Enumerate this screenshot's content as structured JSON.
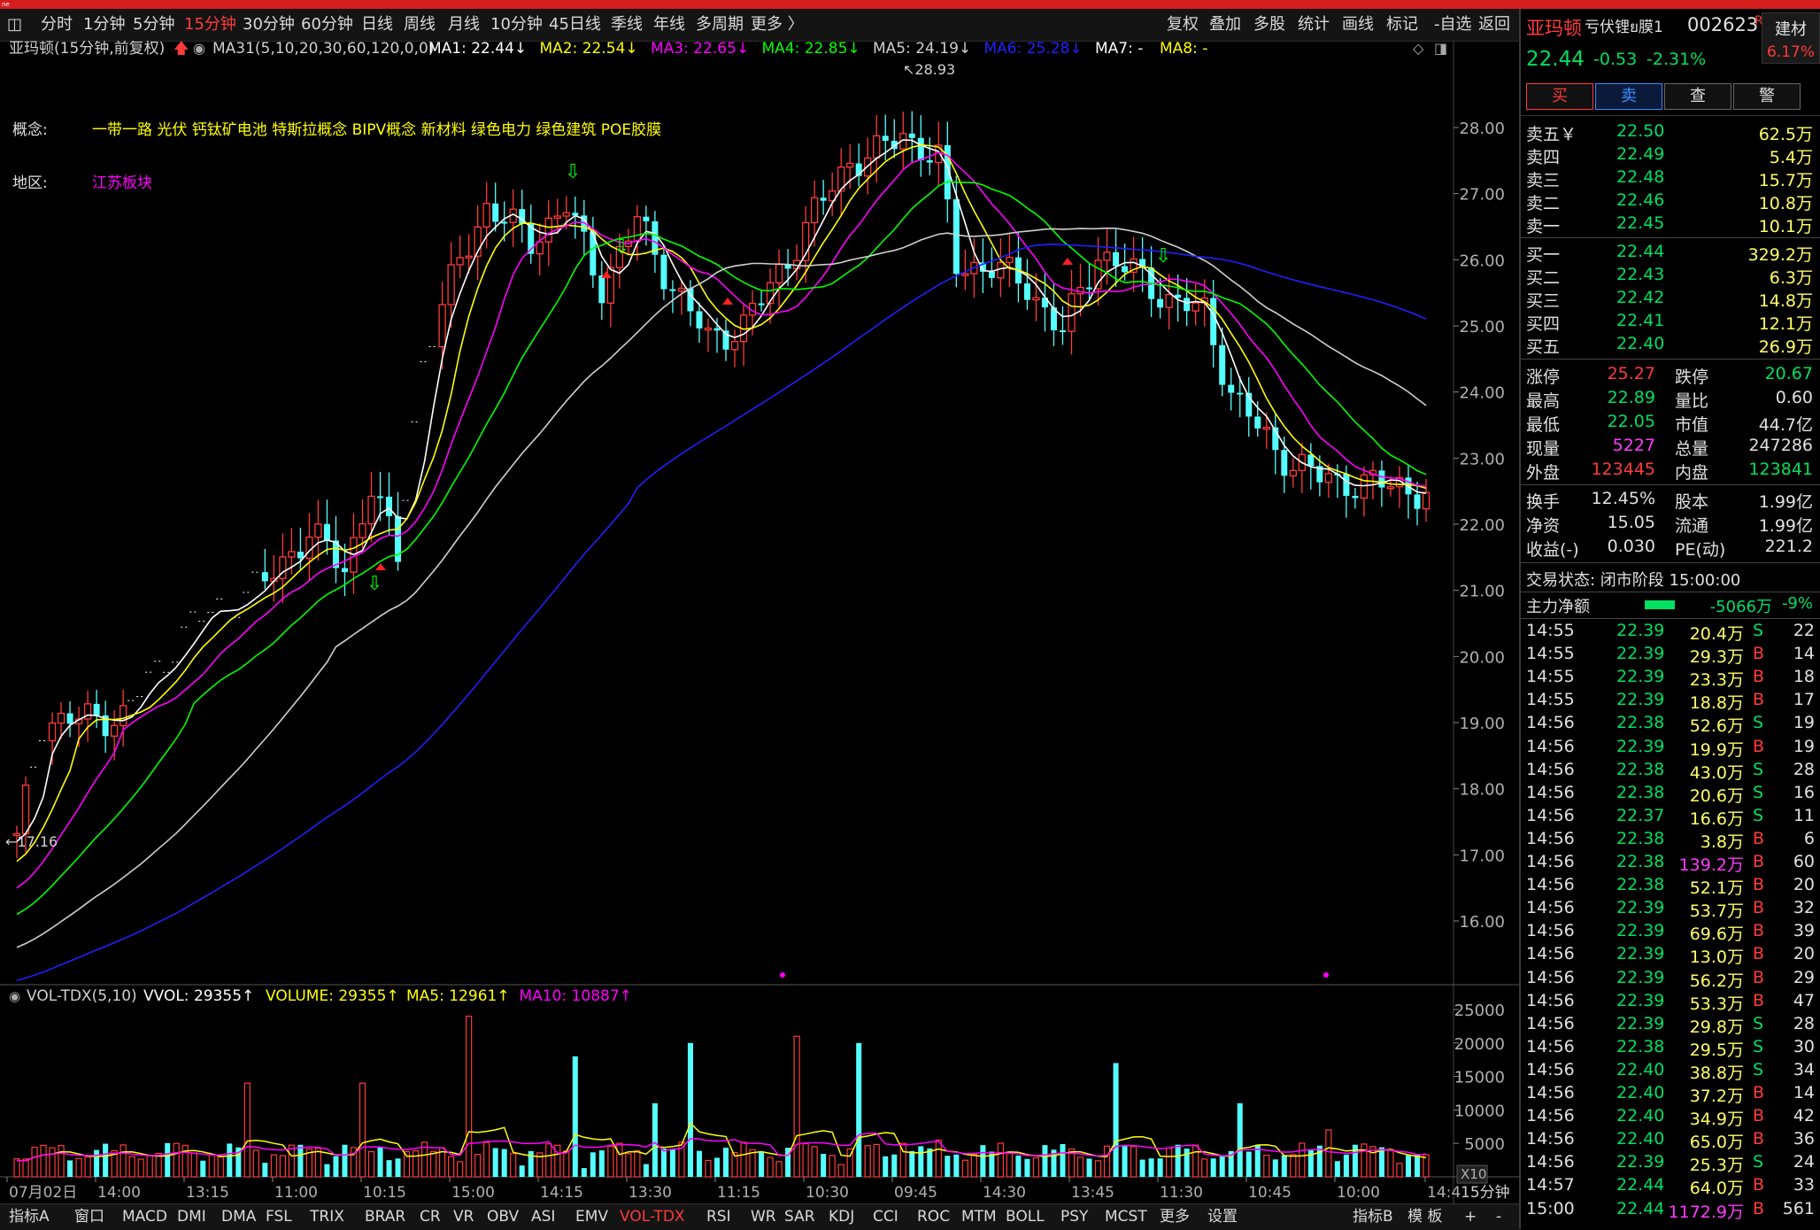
{
  "topbar": {
    "logo": "ne"
  },
  "periods": [
    {
      "label": "分时",
      "active": false
    },
    {
      "label": "1分钟",
      "active": false
    },
    {
      "label": "5分钟",
      "active": false
    },
    {
      "label": "15分钟",
      "active": true
    },
    {
      "label": "30分钟",
      "active": false
    },
    {
      "label": "60分钟",
      "active": false
    },
    {
      "label": "日线",
      "active": false
    },
    {
      "label": "周线",
      "active": false
    },
    {
      "label": "月线",
      "active": false
    },
    {
      "label": "10分钟",
      "active": false
    },
    {
      "label": "45日线",
      "active": false
    },
    {
      "label": "季线",
      "active": false
    },
    {
      "label": "年线",
      "active": false
    },
    {
      "label": "多周期",
      "active": false
    },
    {
      "label": "更多 〉",
      "active": false
    }
  ],
  "tools": [
    "复权",
    "叠加",
    "多股",
    "统计",
    "画线",
    "标记",
    "-自选",
    "返回"
  ],
  "main_chart": {
    "title": "亚玛顿(15分钟,前复权)",
    "ma_indicator": "MA31(5,10,20,30,60,120,0,0)",
    "ma_labels": [
      {
        "text": "MA1: 22.44↓",
        "color": "#ffffff"
      },
      {
        "text": "MA2: 22.54↓",
        "color": "#ffff00"
      },
      {
        "text": "MA3: 22.65↓",
        "color": "#ff00ff"
      },
      {
        "text": "MA4: 22.85↓",
        "color": "#00ff00"
      },
      {
        "text": "MA5: 24.19↓",
        "color": "#d0d0d0"
      },
      {
        "text": "MA6: 25.28↓",
        "color": "#2020ff"
      },
      {
        "text": "MA7: -",
        "color": "#ffffff"
      },
      {
        "text": "MA8: -",
        "color": "#ffff00"
      }
    ],
    "concept_label": "概念:",
    "concept_value": "一带一路 光伏 钙钛矿电池 特斯拉概念 BIPV概念 新材料 绿色电力 绿色建筑 POE胶膜",
    "region_label": "地区:",
    "region_value": "江苏板块",
    "high_label": "28.93",
    "low_label": "17.16",
    "y_axis": [
      "28.00",
      "27.00",
      "26.00",
      "25.00",
      "24.00",
      "23.00",
      "22.00",
      "21.00",
      "20.00",
      "19.00",
      "18.00",
      "17.00",
      "16.00"
    ]
  },
  "volume_chart": {
    "title": "VOL-TDX(5,10)",
    "labels": [
      {
        "text": "VVOL: 29355↑",
        "color": "#ffffff"
      },
      {
        "text": "VOLUME: 29355↑",
        "color": "#ffff00"
      },
      {
        "text": "MA5: 12961↑",
        "color": "#ffff00"
      },
      {
        "text": "MA10: 10887↑",
        "color": "#ff00ff"
      }
    ],
    "y_axis": [
      "25000",
      "20000",
      "15000",
      "10000",
      "5000"
    ],
    "unit": "X10"
  },
  "x_axis": [
    "07月02日",
    "14:00",
    "13:15",
    "11:00",
    "10:15",
    "15:00",
    "14:15",
    "13:30",
    "11:15",
    "10:30",
    "09:45",
    "14:30",
    "13:45",
    "11:30",
    "10:45",
    "10:00",
    "14:4"
  ],
  "x_axis_right": "15分钟",
  "bottom_tabs": [
    {
      "label": "指标A",
      "active": false
    },
    {
      "label": "窗口",
      "active": false
    },
    {
      "label": "MACD",
      "active": false
    },
    {
      "label": "DMI",
      "active": false
    },
    {
      "label": "DMA",
      "active": false
    },
    {
      "label": "FSL",
      "active": false
    },
    {
      "label": "TRIX",
      "active": false
    },
    {
      "label": "BRAR",
      "active": false
    },
    {
      "label": "CR",
      "active": false
    },
    {
      "label": "VR",
      "active": false
    },
    {
      "label": "OBV",
      "active": false
    },
    {
      "label": "ASI",
      "active": false
    },
    {
      "label": "EMV",
      "active": false
    },
    {
      "label": "VOL-TDX",
      "active": true
    },
    {
      "label": "RSI",
      "active": false
    },
    {
      "label": "WR",
      "active": false
    },
    {
      "label": "SAR",
      "active": false
    },
    {
      "label": "KDJ",
      "active": false
    },
    {
      "label": "CCI",
      "active": false
    },
    {
      "label": "ROC",
      "active": false
    },
    {
      "label": "MTM",
      "active": false
    },
    {
      "label": "BOLL",
      "active": false
    },
    {
      "label": "PSY",
      "active": false
    },
    {
      "label": "MCST",
      "active": false
    },
    {
      "label": "更多",
      "active": false
    },
    {
      "label": "设置",
      "active": false
    }
  ],
  "bottom_right": [
    "指标B",
    "模 板",
    "+",
    "-"
  ],
  "quote": {
    "name": "亚玛顿",
    "concept": "亏伏锂ย膜1",
    "code": "002623",
    "flag": "R",
    "sector": "建材",
    "sector_change": "6.17%",
    "price": "22.44",
    "change": "-0.53",
    "change_pct": "-2.31%",
    "buttons": [
      "买",
      "卖",
      "查",
      "警"
    ],
    "asks": [
      {
        "label": "卖五￥",
        "price": "22.50",
        "vol": "62.5万"
      },
      {
        "label": "卖四",
        "price": "22.49",
        "vol": "5.4万"
      },
      {
        "label": "卖三",
        "price": "22.48",
        "vol": "15.7万"
      },
      {
        "label": "卖二",
        "price": "22.46",
        "vol": "10.8万"
      },
      {
        "label": "卖一",
        "price": "22.45",
        "vol": "10.1万"
      }
    ],
    "bids": [
      {
        "label": "买一",
        "price": "22.44",
        "vol": "329.2万"
      },
      {
        "label": "买二",
        "price": "22.43",
        "vol": "6.3万"
      },
      {
        "label": "买三",
        "price": "22.42",
        "vol": "14.8万"
      },
      {
        "label": "买四",
        "price": "22.41",
        "vol": "12.1万"
      },
      {
        "label": "买五",
        "price": "22.40",
        "vol": "26.9万"
      }
    ],
    "stats": [
      {
        "l1": "涨停",
        "v1": "25.27",
        "c1": "#ff3b3b",
        "l2": "跌停",
        "v2": "20.67",
        "c2": "#00e060"
      },
      {
        "l1": "最高",
        "v1": "22.89",
        "c1": "#00e060",
        "l2": "量比",
        "v2": "0.60",
        "c2": "#e0e0e0"
      },
      {
        "l1": "最低",
        "v1": "22.05",
        "c1": "#00e060",
        "l2": "市值",
        "v2": "44.7亿",
        "c2": "#e0e0e0"
      },
      {
        "l1": "现量",
        "v1": "5227",
        "c1": "#ff3bff",
        "l2": "总量",
        "v2": "247286",
        "c2": "#e0e0e0"
      },
      {
        "l1": "外盘",
        "v1": "123445",
        "c1": "#ff3b3b",
        "l2": "内盘",
        "v2": "123841",
        "c2": "#00e060"
      }
    ],
    "stats2": [
      {
        "l1": "换手",
        "v1": "12.45%",
        "l2": "股本",
        "v2": "1.99亿"
      },
      {
        "l1": "净资",
        "v1": "15.05",
        "l2": "流通",
        "v2": "1.99亿"
      },
      {
        "l1": "收益(-)",
        "v1": "0.030",
        "l2": "PE(动)",
        "v2": "221.2"
      }
    ],
    "trade_state": "交易状态: 闭市阶段 15:00:00",
    "main_flow_label": "主力净额",
    "main_flow_value": "-5066万",
    "main_flow_pct": "-9%",
    "ticks": [
      [
        "14:55",
        "22.39",
        "20.4万",
        "S",
        "22"
      ],
      [
        "14:55",
        "22.39",
        "29.3万",
        "B",
        "14"
      ],
      [
        "14:55",
        "22.39",
        "23.3万",
        "B",
        "18"
      ],
      [
        "14:55",
        "22.39",
        "18.8万",
        "B",
        "17"
      ],
      [
        "14:56",
        "22.38",
        "52.6万",
        "S",
        "19"
      ],
      [
        "14:56",
        "22.39",
        "19.9万",
        "B",
        "19"
      ],
      [
        "14:56",
        "22.38",
        "43.0万",
        "S",
        "28"
      ],
      [
        "14:56",
        "22.38",
        "20.6万",
        "S",
        "16"
      ],
      [
        "14:56",
        "22.37",
        "16.6万",
        "S",
        "11"
      ],
      [
        "14:56",
        "22.38",
        "3.8万",
        "B",
        "6"
      ],
      [
        "14:56",
        "22.38",
        "139.2万",
        "B",
        "60"
      ],
      [
        "14:56",
        "22.38",
        "52.1万",
        "B",
        "20"
      ],
      [
        "14:56",
        "22.39",
        "53.7万",
        "B",
        "32"
      ],
      [
        "14:56",
        "22.39",
        "69.6万",
        "B",
        "39"
      ],
      [
        "14:56",
        "22.39",
        "13.0万",
        "B",
        "20"
      ],
      [
        "14:56",
        "22.39",
        "56.2万",
        "B",
        "29"
      ],
      [
        "14:56",
        "22.39",
        "53.3万",
        "B",
        "47"
      ],
      [
        "14:56",
        "22.39",
        "29.8万",
        "S",
        "28"
      ],
      [
        "14:56",
        "22.38",
        "29.5万",
        "S",
        "30"
      ],
      [
        "14:56",
        "22.40",
        "38.8万",
        "S",
        "34"
      ],
      [
        "14:56",
        "22.40",
        "37.2万",
        "B",
        "14"
      ],
      [
        "14:56",
        "22.40",
        "34.9万",
        "B",
        "42"
      ],
      [
        "14:56",
        "22.40",
        "65.0万",
        "B",
        "36"
      ],
      [
        "14:56",
        "22.39",
        "25.3万",
        "S",
        "24"
      ],
      [
        "14:57",
        "22.44",
        "64.0万",
        "B",
        "33"
      ],
      [
        "15:00",
        "22.44",
        "1172.9万",
        "B",
        "561"
      ]
    ]
  },
  "colors": {
    "up": "#ff3b3b",
    "down": "#54ffff",
    "bg": "#000000",
    "ma1": "#ffffff",
    "ma2": "#ffff00",
    "ma3": "#ff00ff",
    "ma4": "#00ff00",
    "ma5": "#d0d0d0",
    "ma6": "#2020ff"
  }
}
